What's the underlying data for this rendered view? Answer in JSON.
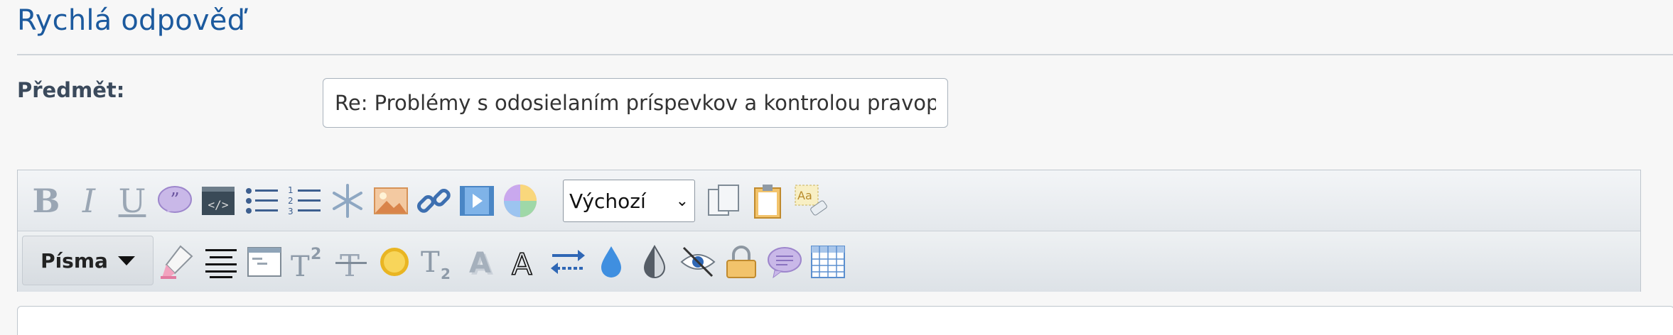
{
  "page": {
    "title": "Rychlá odpověď"
  },
  "subject": {
    "label": "Předmět:",
    "value": "Re: Problémy s odosielaním príspevkov a kontrolou pravop"
  },
  "toolbar": {
    "row1_icons": [
      "bold-icon",
      "italic-icon",
      "underline-icon",
      "quote-icon",
      "code-icon",
      "bullet-list-icon",
      "numbered-list-icon",
      "asterisk-icon",
      "image-icon",
      "link-icon",
      "video-icon",
      "color-wheel-icon",
      "copy-icon",
      "paste-icon",
      "remove-format-icon"
    ],
    "size_select": {
      "selected": "Výchozí"
    },
    "fonts_button": {
      "label": "Písma"
    },
    "row2_icons": [
      "highlighter-icon",
      "align-center-icon",
      "window-icon",
      "superscript-icon",
      "strikethrough-icon",
      "glow-icon",
      "subscript-icon",
      "shadow-icon",
      "outline-icon",
      "swap-direction-icon",
      "drop-icon",
      "contrast-icon",
      "hide-icon",
      "lock-icon",
      "speech-bubble-icon",
      "table-icon"
    ]
  }
}
